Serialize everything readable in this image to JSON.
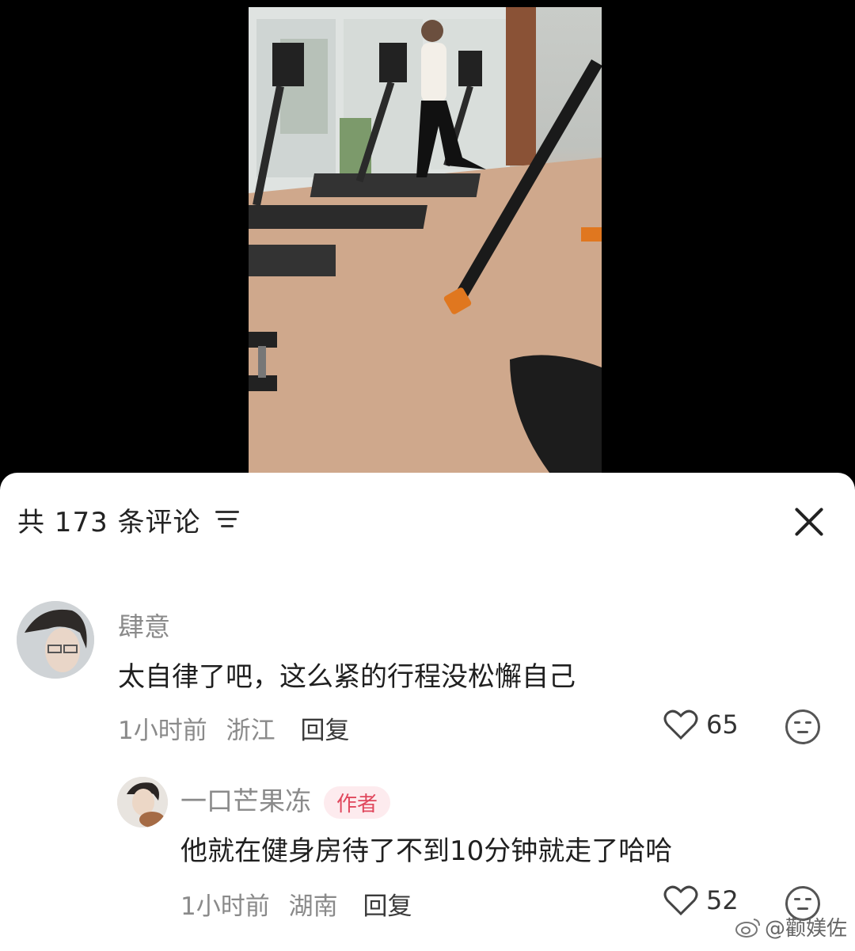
{
  "video": {},
  "panel": {
    "title": "共 173 条评论"
  },
  "comments": [
    {
      "username": "肆意",
      "text": "太自律了吧，这么紧的行程没松懈自己",
      "time": "1小时前",
      "location": "浙江",
      "reply_label": "回复",
      "likes": "65"
    }
  ],
  "replies": [
    {
      "username": "一口芒果冻",
      "badge": "作者",
      "text": "他就在健身房待了不到10分钟就走了哈哈",
      "time": "1小时前",
      "location": "湖南",
      "reply_label": "回复",
      "likes": "52"
    }
  ],
  "watermark": "@颧媄佐",
  "colors": {
    "badge_bg": "#fdebee",
    "badge_text": "#e0485d"
  }
}
